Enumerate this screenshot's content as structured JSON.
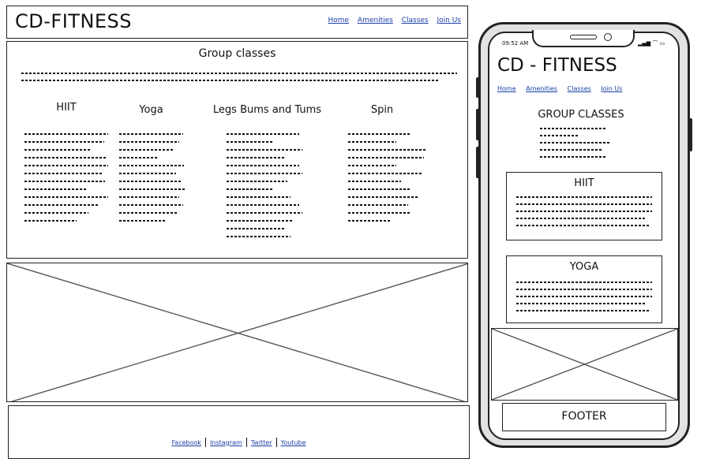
{
  "desktop": {
    "brand": "CD-FITNESS",
    "nav": [
      "Home",
      "Amenities",
      "Classes",
      "Join Us"
    ],
    "section_title": "Group classes",
    "classes": [
      {
        "title": "HIIT"
      },
      {
        "title": "Yoga"
      },
      {
        "title": "Legs Bums and Tums"
      },
      {
        "title": "Spin"
      }
    ],
    "social": [
      "Facebook",
      "Instagram",
      "Twitter",
      "Youtube"
    ]
  },
  "mobile": {
    "time": "09:52 AM",
    "brand": "CD - FITNESS",
    "nav": [
      "Home",
      "Amenities",
      "Classes",
      "Join Us"
    ],
    "section_title": "GROUP CLASSES",
    "cards": [
      {
        "title": "HIIT"
      },
      {
        "title": "YOGA"
      }
    ],
    "footer": "FOOTER"
  }
}
